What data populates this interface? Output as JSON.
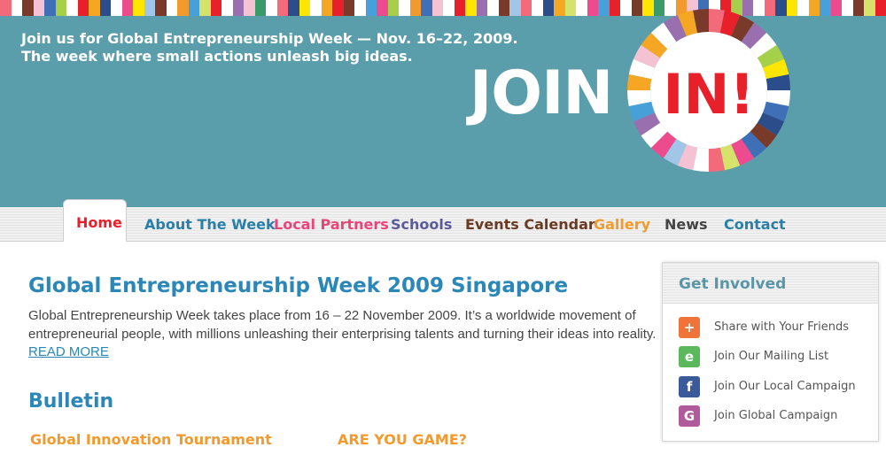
{
  "stripe_colors": [
    "#f36a7b",
    "#ffffff",
    "#7a3a2a",
    "#f4c2d2",
    "#3f6fb6",
    "#a7d04a",
    "#ffffff",
    "#e8202a",
    "#f5a623",
    "#2b4d8a",
    "#ffffff",
    "#ee4a8e",
    "#ffe600",
    "#a1c6e8",
    "#7a3a2a",
    "#ffffff",
    "#f29a2e",
    "#48a0d8",
    "#d5e36b",
    "#e8202a",
    "#ffffff",
    "#9a6fb0",
    "#f4c2d2",
    "#3a9a6a",
    "#ffffff",
    "#f36a7b",
    "#2b4d8a",
    "#ffe600",
    "#ffffff",
    "#f5a623",
    "#e8202a",
    "#7a3a2a",
    "#ffffff",
    "#48a0d8",
    "#ee4a8e",
    "#a7d04a",
    "#ffffff",
    "#f29a2e",
    "#3f6fb6",
    "#f4c2d2",
    "#ffffff",
    "#e8202a",
    "#ffe600",
    "#9a6fb0",
    "#ffffff",
    "#7a3a2a",
    "#a1c6e8",
    "#f36a7b",
    "#ffffff",
    "#2b4d8a",
    "#f5a623",
    "#d5e36b",
    "#ffffff",
    "#ee4a8e",
    "#48a0d8",
    "#e8202a",
    "#ffffff",
    "#7a3a2a",
    "#ffe600",
    "#3a9a6a",
    "#ffffff",
    "#f29a2e",
    "#f4c2d2",
    "#3f6fb6",
    "#ffffff",
    "#e8202a",
    "#a7d04a",
    "#9a6fb0",
    "#ffffff",
    "#f36a7b",
    "#2b4d8a",
    "#ffe600",
    "#ffffff",
    "#f5a623",
    "#48a0d8",
    "#ee4a8e",
    "#ffffff",
    "#7a3a2a",
    "#d5e36b",
    "#e8202a"
  ],
  "banner": {
    "tagline_line1": "Join us for Global Entrepreneurship Week — Nov. 16–22, 2009.",
    "tagline_line2": "The week where small actions unleash big ideas.",
    "logo_word": "JOIN",
    "logo_in": "IN!"
  },
  "nav": {
    "home": "Home",
    "about": "About The Week",
    "partners": "Local Partners",
    "schools": "Schools",
    "events": "Events Calendar",
    "gallery": "Gallery",
    "news": "News",
    "contact": "Contact"
  },
  "main": {
    "title": "Global Entrepreneurship Week 2009 Singapore",
    "intro": "Global Entrepreneurship Week takes place from 16 – 22 November 2009. It’s a worldwide movement of entrepreneurial people, with millions unleashing their enterprising talents and turning their ideas into reality. ",
    "read_more": "READ MORE",
    "bulletin_title": "Bulletin",
    "bulletin_items": [
      "Global Innovation Tournament",
      "ARE YOU GAME?"
    ]
  },
  "sidebar": {
    "title": "Get Involved",
    "items": [
      {
        "label": "Share with Your Friends",
        "icon": "plus-icon",
        "glyph": "+",
        "color": "#f0743a"
      },
      {
        "label": "Join Our Mailing List",
        "icon": "mail-list-icon",
        "glyph": "e",
        "color": "#5cb85c"
      },
      {
        "label": "Join Our Local Campaign",
        "icon": "facebook-icon",
        "glyph": "f",
        "color": "#3b5a9a"
      },
      {
        "label": "Join Global Campaign",
        "icon": "global-campaign-icon",
        "glyph": "G",
        "color": "#b05b9c"
      }
    ]
  },
  "colors": {
    "banner": "#5b9eab",
    "nav_home": "#e8202a",
    "nav_about": "#2a7fa8",
    "nav_partners": "#e8457a",
    "nav_schools": "#5b5b99",
    "nav_events": "#6b3a22",
    "nav_gallery": "#f29a2e",
    "nav_news": "#444444",
    "nav_contact": "#2a7fa8",
    "heading": "#2a87b8",
    "bulletin_item": "#f29a2e"
  }
}
